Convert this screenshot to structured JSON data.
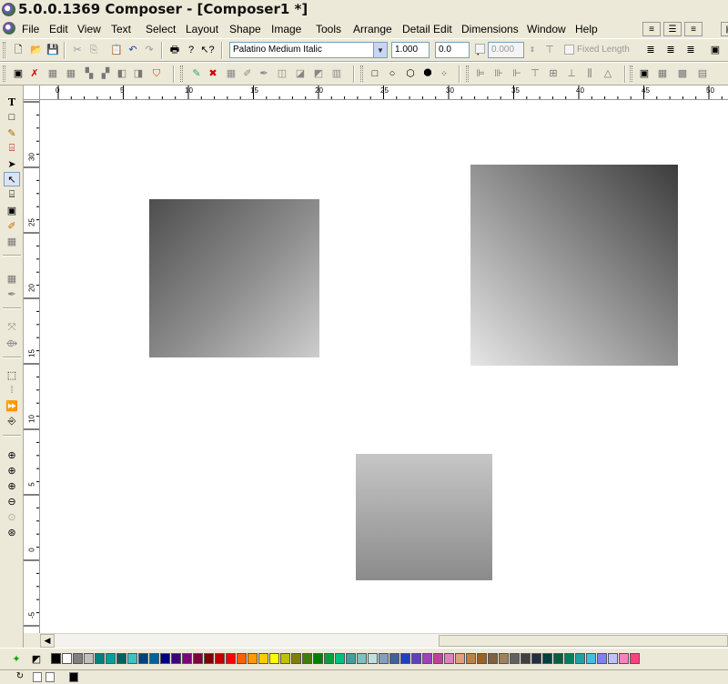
{
  "window": {
    "title": "5.0.0.1369 Composer - [Composer1 *]"
  },
  "menu": {
    "items": [
      "File",
      "Edit",
      "View",
      "Text",
      "Select",
      "Layout",
      "Shape",
      "Image",
      "Tools",
      "Arrange",
      "Detail Edit",
      "Dimensions",
      "Window",
      "Help"
    ]
  },
  "format_toolbar": {
    "font_name": "Palatino Medium Italic",
    "scale_value": "1.000",
    "angle_value": "0.0",
    "length_value": "0.000",
    "fixed_length_label": "Fixed Length"
  },
  "icons": {
    "title": "app-logo-icon",
    "menu": "app-menu-icon"
  },
  "rulers": {
    "horizontal_labels": [
      "0",
      "5",
      "10",
      "15",
      "20",
      "25",
      "30",
      "35",
      "40",
      "45",
      "50"
    ],
    "vertical_labels": [
      "30",
      "25",
      "20",
      "15",
      "10",
      "5",
      "0",
      "-5"
    ]
  },
  "canvas": {
    "background": "#ffffff",
    "shapes": [
      {
        "name": "gradient-rectangle-1",
        "gradient": "dark top-left to light bottom-right"
      },
      {
        "name": "gradient-rectangle-2",
        "gradient": "light bottom-left to dark top-right"
      },
      {
        "name": "gradient-rectangle-3",
        "gradient": "light top to dark bottom"
      }
    ]
  },
  "palette": {
    "colors": [
      "#000000",
      "#ffffff",
      "#808080",
      "#c0c0c0",
      "#008080",
      "#00a0a0",
      "#006060",
      "#40c0c0",
      "#004080",
      "#0060a0",
      "#000080",
      "#400080",
      "#800080",
      "#800040",
      "#800000",
      "#c00000",
      "#ff0000",
      "#ff6000",
      "#ff9900",
      "#ffcc00",
      "#ffff00",
      "#c0c000",
      "#808000",
      "#408000",
      "#008000",
      "#00a040",
      "#00c080",
      "#40a0a0",
      "#80c0c0",
      "#c0e0e0",
      "#80a0c0",
      "#4060a0",
      "#2040c0",
      "#6040c0",
      "#a040c0",
      "#c040a0",
      "#e080c0",
      "#e0a080",
      "#c08040",
      "#a06020",
      "#806040",
      "#a08060",
      "#606060",
      "#404040",
      "#203040",
      "#004040",
      "#006040",
      "#008060",
      "#20a0a0",
      "#40c0e0",
      "#8080ff",
      "#c0c0ff",
      "#ff80c0",
      "#ff4080"
    ]
  }
}
